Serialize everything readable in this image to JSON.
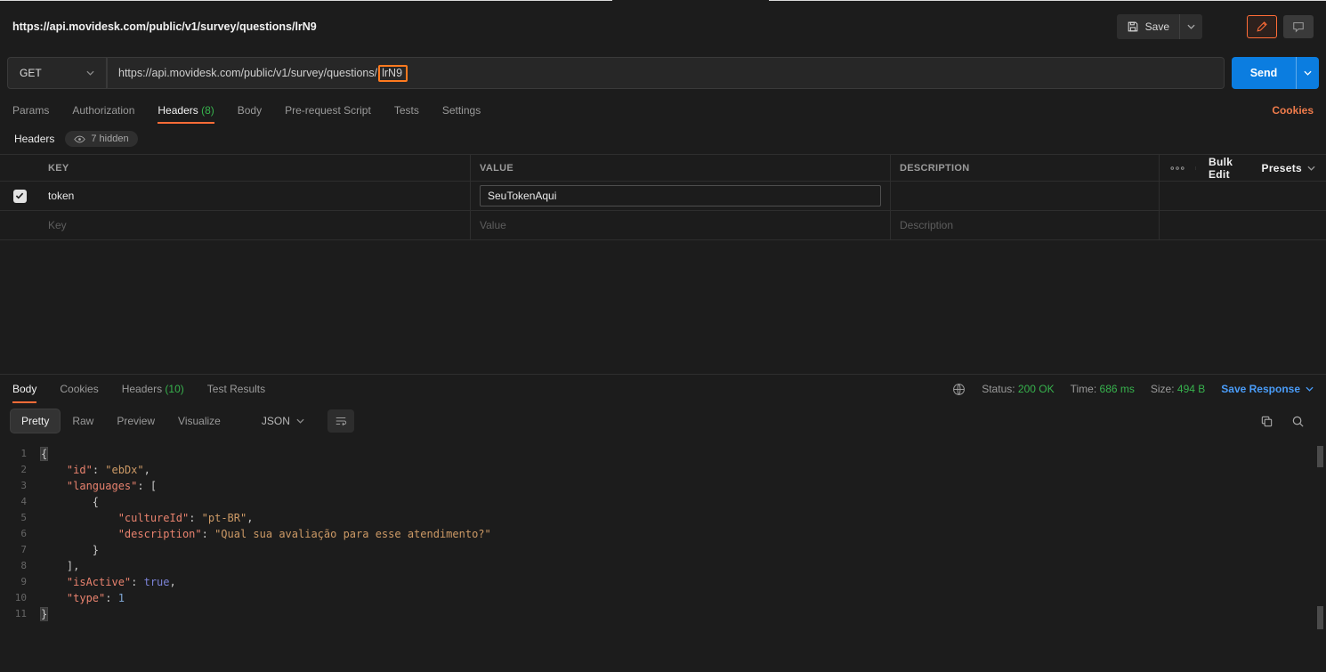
{
  "colors": {
    "accent_orange": "#ff6c37",
    "send_blue": "#0b7de0",
    "status_green": "#37b24d",
    "link_blue": "#4a9cf8"
  },
  "topbar": {
    "title": "https://api.movidesk.com/public/v1/survey/questions/lrN9",
    "save_label": "Save"
  },
  "request": {
    "method": "GET",
    "url_prefix": "https://api.movidesk.com/public/v1/survey/questions/",
    "url_highlight": "lrN9",
    "send_label": "Send",
    "cookies_link": "Cookies",
    "tabs": [
      {
        "label": "Params",
        "count": ""
      },
      {
        "label": "Authorization",
        "count": ""
      },
      {
        "label": "Headers",
        "count": "(8)",
        "active": true
      },
      {
        "label": "Body",
        "count": ""
      },
      {
        "label": "Pre-request Script",
        "count": ""
      },
      {
        "label": "Tests",
        "count": ""
      },
      {
        "label": "Settings",
        "count": ""
      }
    ]
  },
  "headers_editor": {
    "title": "Headers",
    "hidden_badge": "7 hidden",
    "col_key": "KEY",
    "col_value": "VALUE",
    "col_description": "DESCRIPTION",
    "bulk_edit": "Bulk Edit",
    "presets": "Presets",
    "row": {
      "key": "token",
      "value": "SeuTokenAqui",
      "description": ""
    },
    "placeholders": {
      "key": "Key",
      "value": "Value",
      "description": "Description"
    }
  },
  "response": {
    "tabs": [
      {
        "label": "Body",
        "count": "",
        "active": true
      },
      {
        "label": "Cookies",
        "count": ""
      },
      {
        "label": "Headers",
        "count": "(10)"
      },
      {
        "label": "Test Results",
        "count": ""
      }
    ],
    "status_label": "Status:",
    "status_value": "200 OK",
    "time_label": "Time:",
    "time_value": "686 ms",
    "size_label": "Size:",
    "size_value": "494 B",
    "save_response_label": "Save Response",
    "view_tabs": [
      {
        "label": "Pretty",
        "active": true
      },
      {
        "label": "Raw"
      },
      {
        "label": "Preview"
      },
      {
        "label": "Visualize"
      }
    ],
    "format_select": "JSON",
    "code": {
      "lines": [
        {
          "n": 1,
          "hl": true,
          "tokens": [
            [
              "p",
              "{"
            ]
          ]
        },
        {
          "n": 2,
          "tokens": [
            [
              "p",
              "    "
            ],
            [
              "k",
              "\"id\""
            ],
            [
              "p",
              ": "
            ],
            [
              "s",
              "\"ebDx\""
            ],
            [
              "p",
              ","
            ]
          ]
        },
        {
          "n": 3,
          "tokens": [
            [
              "p",
              "    "
            ],
            [
              "k",
              "\"languages\""
            ],
            [
              "p",
              ": ["
            ]
          ]
        },
        {
          "n": 4,
          "tokens": [
            [
              "p",
              "        {"
            ]
          ]
        },
        {
          "n": 5,
          "tokens": [
            [
              "p",
              "            "
            ],
            [
              "k",
              "\"cultureId\""
            ],
            [
              "p",
              ": "
            ],
            [
              "s",
              "\"pt-BR\""
            ],
            [
              "p",
              ","
            ]
          ]
        },
        {
          "n": 6,
          "tokens": [
            [
              "p",
              "            "
            ],
            [
              "k",
              "\"description\""
            ],
            [
              "p",
              ": "
            ],
            [
              "s",
              "\"Qual sua avaliação para esse atendimento?\""
            ]
          ]
        },
        {
          "n": 7,
          "tokens": [
            [
              "p",
              "        }"
            ]
          ]
        },
        {
          "n": 8,
          "tokens": [
            [
              "p",
              "    ],"
            ]
          ]
        },
        {
          "n": 9,
          "tokens": [
            [
              "p",
              "    "
            ],
            [
              "k",
              "\"isActive\""
            ],
            [
              "p",
              ": "
            ],
            [
              "b",
              "true"
            ],
            [
              "p",
              ","
            ]
          ]
        },
        {
          "n": 10,
          "tokens": [
            [
              "p",
              "    "
            ],
            [
              "k",
              "\"type\""
            ],
            [
              "p",
              ": "
            ],
            [
              "n",
              "1"
            ]
          ]
        },
        {
          "n": 11,
          "hl": true,
          "tokens": [
            [
              "p",
              "}"
            ]
          ]
        }
      ]
    }
  }
}
